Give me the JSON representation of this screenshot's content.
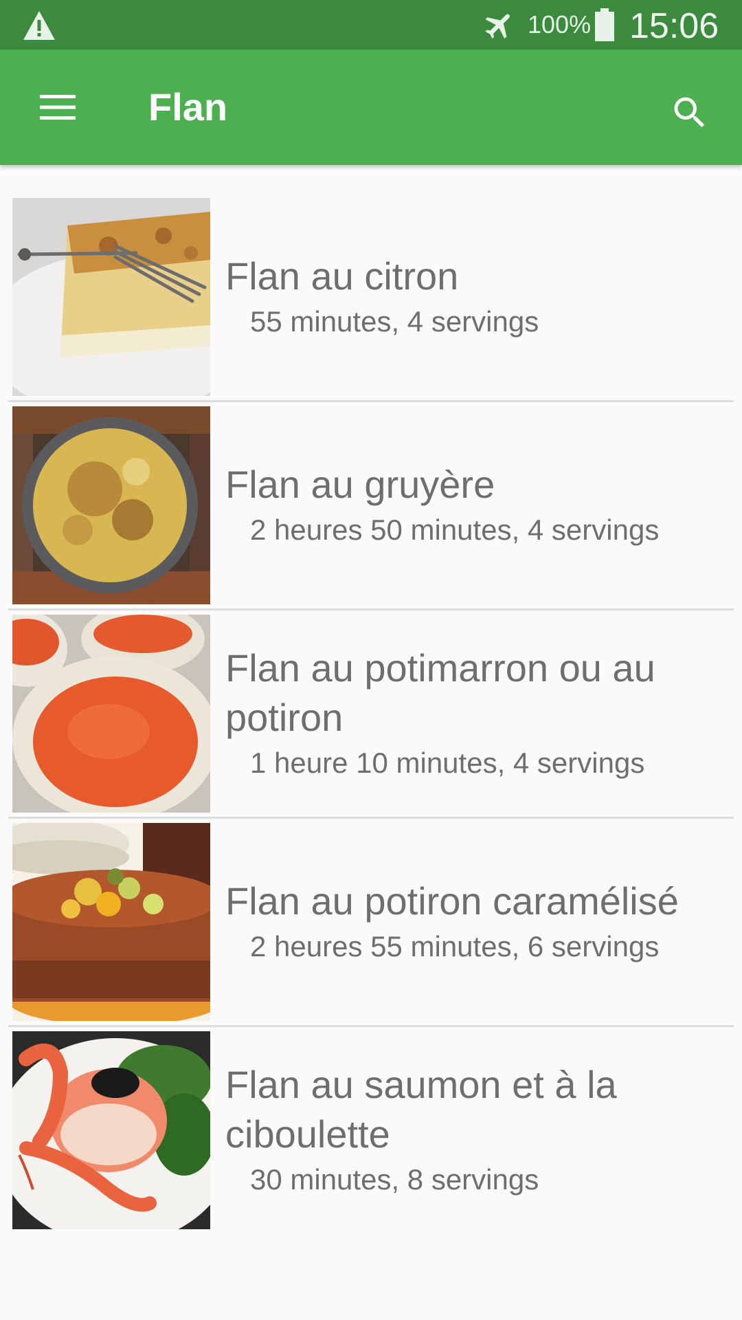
{
  "status_bar": {
    "battery_percent": "100%",
    "time": "15:06",
    "icons": [
      "warning-icon",
      "airplane-mode-icon",
      "battery-icon"
    ]
  },
  "app_bar": {
    "title": "Flan",
    "icons": [
      "menu-icon",
      "search-icon"
    ],
    "color": "#4caf50"
  },
  "recipes": [
    {
      "title": "Flan au citron",
      "meta": "55 minutes, 4 servings"
    },
    {
      "title": "Flan au gruyère",
      "meta": "2 heures 50 minutes, 4 servings"
    },
    {
      "title": "Flan au potimarron ou au potiron",
      "meta": "1 heure 10 minutes, 4 servings"
    },
    {
      "title": "Flan au potiron caramélisé",
      "meta": "2 heures 55 minutes, 6 servings"
    },
    {
      "title": "Flan au saumon et à la ciboulette",
      "meta": "30 minutes, 8 servings"
    }
  ]
}
